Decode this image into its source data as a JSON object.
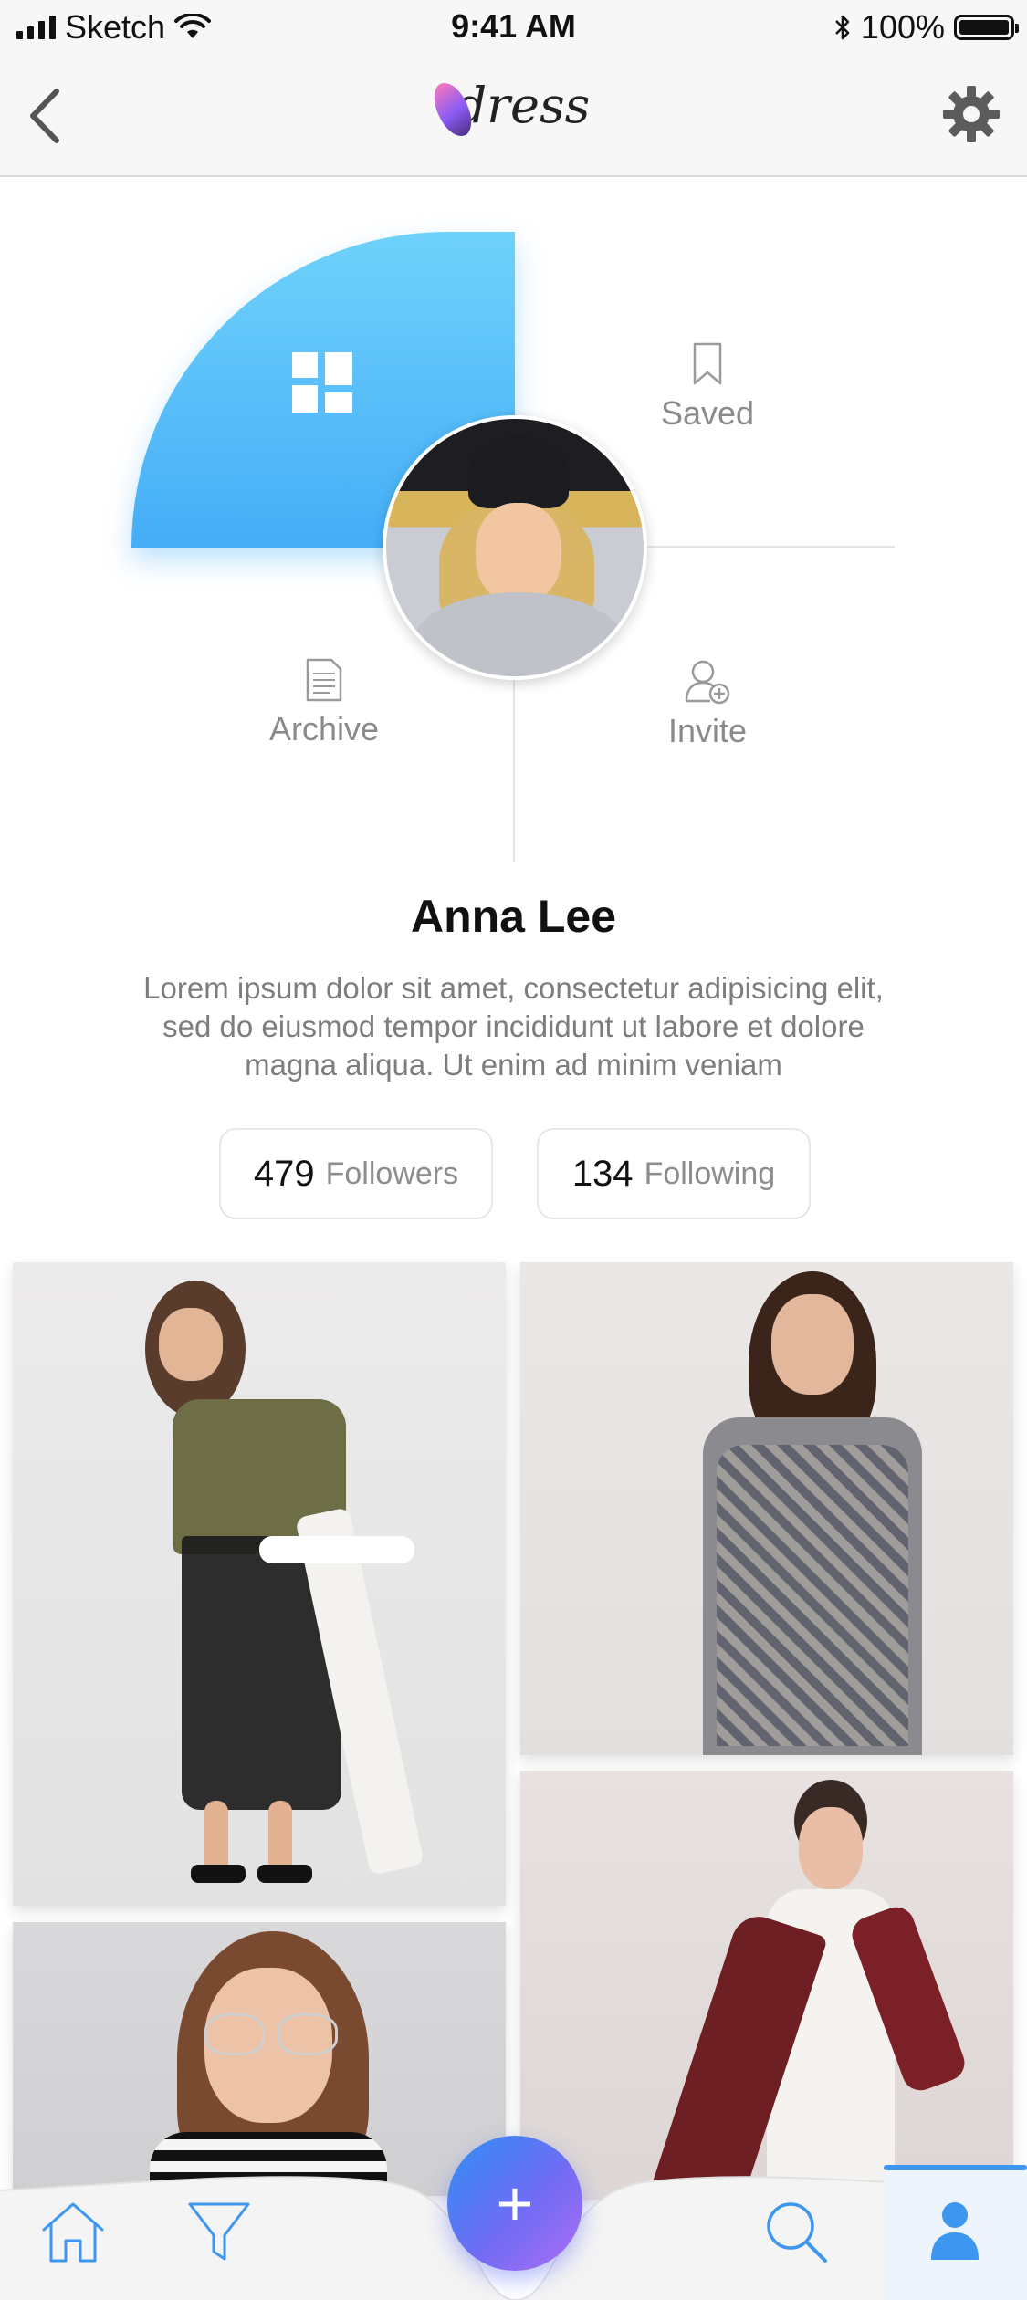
{
  "status_bar": {
    "carrier": "Sketch",
    "time": "9:41 AM",
    "battery_percent": "100%"
  },
  "nav": {
    "logo_text": "dress",
    "back_icon": "chevron-left-icon",
    "settings_icon": "gear-icon"
  },
  "profile_menu": {
    "dashboard_icon": "grid-icon",
    "saved_label": "Saved",
    "archive_label": "Archive",
    "invite_label": "Invite",
    "accent_gradient": [
      "#6fd2fb",
      "#45adf7"
    ]
  },
  "profile": {
    "name": "Anna Lee",
    "bio": "Lorem ipsum dolor sit amet, consectetur adipisicing elit, sed do eiusmod tempor incididunt ut labore et dolore magna aliqua. Ut enim ad minim veniam"
  },
  "stats": {
    "followers_count": "479",
    "followers_label": "Followers",
    "following_count": "134",
    "following_label": "Following"
  },
  "photos": [
    {
      "name": "photo-olive-top-lace-skirt"
    },
    {
      "name": "photo-printed-kurta"
    },
    {
      "name": "photo-striped-tee-glasses"
    },
    {
      "name": "photo-white-dress-maroon-cape"
    }
  ],
  "tab_bar": {
    "items": [
      "home-icon",
      "filter-icon",
      "add-button",
      "search-icon",
      "profile-icon"
    ],
    "fab_label": "+",
    "active_item": "profile",
    "accent_color": "#3d96f0"
  }
}
